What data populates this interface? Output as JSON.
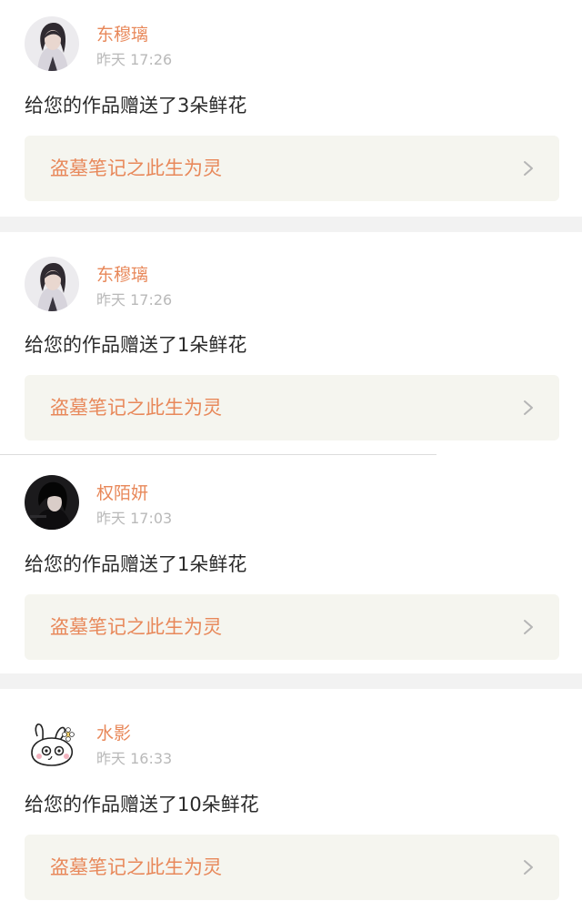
{
  "colors": {
    "accent": "#e8885a",
    "muted_text": "#b9b9b9",
    "body_text": "#2b2b2b",
    "link_background": "#f5f5ef",
    "separator": "#f2f2f2"
  },
  "notifications": [
    {
      "user": {
        "name": "东穆璃",
        "avatar_icon": "portrait-avatar"
      },
      "time": "昨天 17:26",
      "message": "给您的作品赠送了3朵鲜花",
      "work": {
        "title": "盗墓笔记之此生为灵",
        "chevron_icon": "chevron-right-icon"
      }
    },
    {
      "user": {
        "name": "东穆璃",
        "avatar_icon": "portrait-avatar"
      },
      "time": "昨天 17:26",
      "message": "给您的作品赠送了1朵鲜花",
      "work": {
        "title": "盗墓笔记之此生为灵",
        "chevron_icon": "chevron-right-icon"
      }
    },
    {
      "user": {
        "name": "权陌妍",
        "avatar_icon": "dark-portrait-avatar"
      },
      "time": "昨天 17:03",
      "message": "给您的作品赠送了1朵鲜花",
      "work": {
        "title": "盗墓笔记之此生为灵",
        "chevron_icon": "chevron-right-icon"
      }
    },
    {
      "user": {
        "name": "水影",
        "avatar_icon": "bunny-doodle-avatar"
      },
      "time": "昨天 16:33",
      "message": "给您的作品赠送了10朵鲜花",
      "work": {
        "title": "盗墓笔记之此生为灵",
        "chevron_icon": "chevron-right-icon"
      }
    }
  ]
}
